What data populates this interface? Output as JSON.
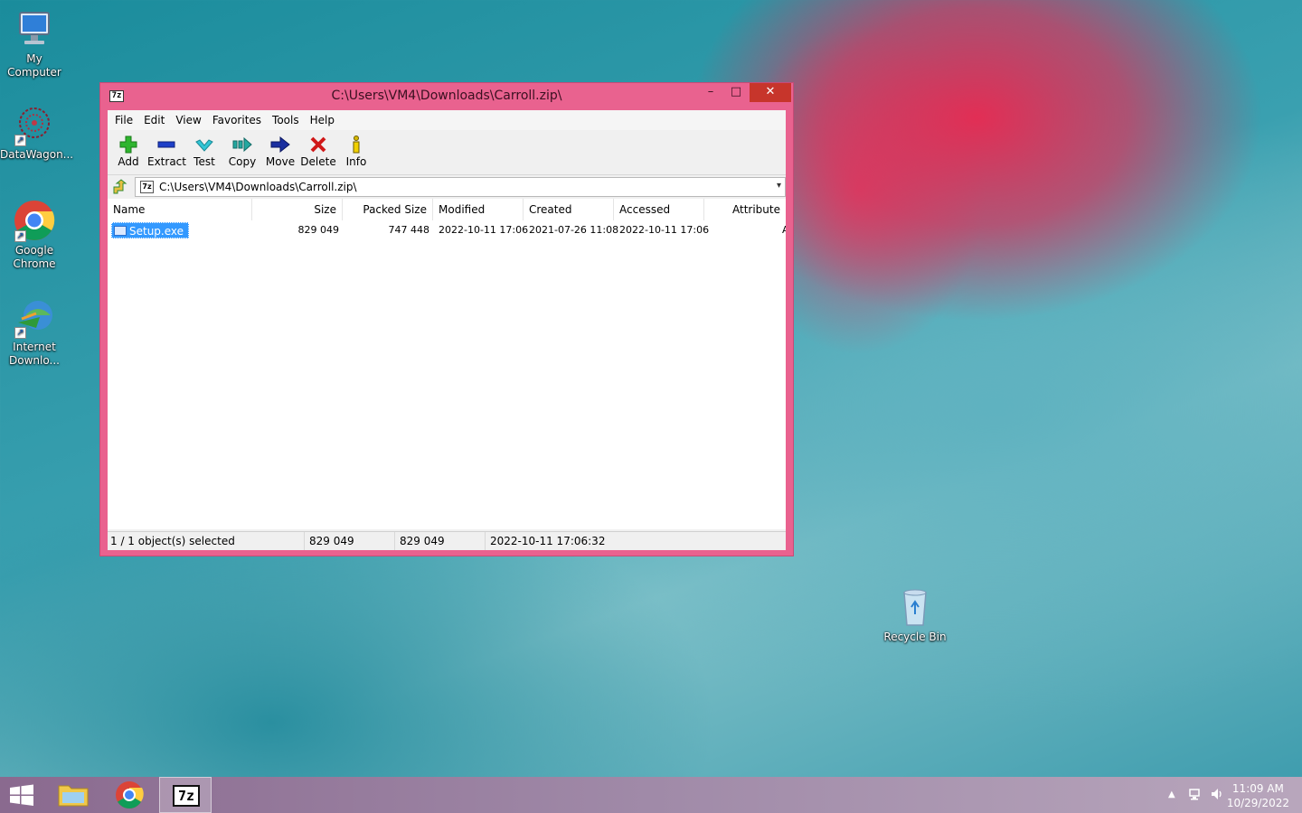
{
  "desktop": {
    "icons": [
      {
        "label": "My\nComputer",
        "line1": "My",
        "line2": "Computer"
      },
      {
        "line1": "DataWagon...",
        "line2": ""
      },
      {
        "line1": "Google",
        "line2": "Chrome"
      },
      {
        "line1": "Internet",
        "line2": "Downlo..."
      },
      {
        "line1": "Recycle Bin",
        "line2": ""
      }
    ]
  },
  "window": {
    "app_icon": "7z",
    "title": "C:\\Users\\VM4\\Downloads\\Carroll.zip\\",
    "controls": {
      "minimize": "–",
      "maximize": "□",
      "close": "✕"
    },
    "menu": [
      "File",
      "Edit",
      "View",
      "Favorites",
      "Tools",
      "Help"
    ],
    "toolbar": [
      {
        "label": "Add",
        "icon": "add-icon"
      },
      {
        "label": "Extract",
        "icon": "extract-icon"
      },
      {
        "label": "Test",
        "icon": "test-icon"
      },
      {
        "label": "Copy",
        "icon": "copy-icon"
      },
      {
        "label": "Move",
        "icon": "move-icon"
      },
      {
        "label": "Delete",
        "icon": "delete-icon"
      },
      {
        "label": "Info",
        "icon": "info-icon"
      }
    ],
    "address": "C:\\Users\\VM4\\Downloads\\Carroll.zip\\",
    "columns": [
      "Name",
      "Size",
      "Packed Size",
      "Modified",
      "Created",
      "Accessed",
      "Attribute"
    ],
    "rows": [
      {
        "name": "Setup.exe",
        "size": "829 049",
        "packed_size": "747 448",
        "modified": "2022-10-11 17:06",
        "created": "2021-07-26 11:08",
        "accessed": "2022-10-11 17:06",
        "attributes": "A"
      }
    ],
    "status": {
      "selection": "1 / 1 object(s) selected",
      "size": "829 049",
      "packed": "829 049",
      "modified": "2022-10-11 17:06:32"
    }
  },
  "taskbar": {
    "clock_time": "11:09 AM",
    "clock_date": "10/29/2022",
    "active_app_label": "7z"
  },
  "colors": {
    "window_frame": "#e9628f",
    "close_button": "#c7352b",
    "selection": "#3399ff"
  }
}
